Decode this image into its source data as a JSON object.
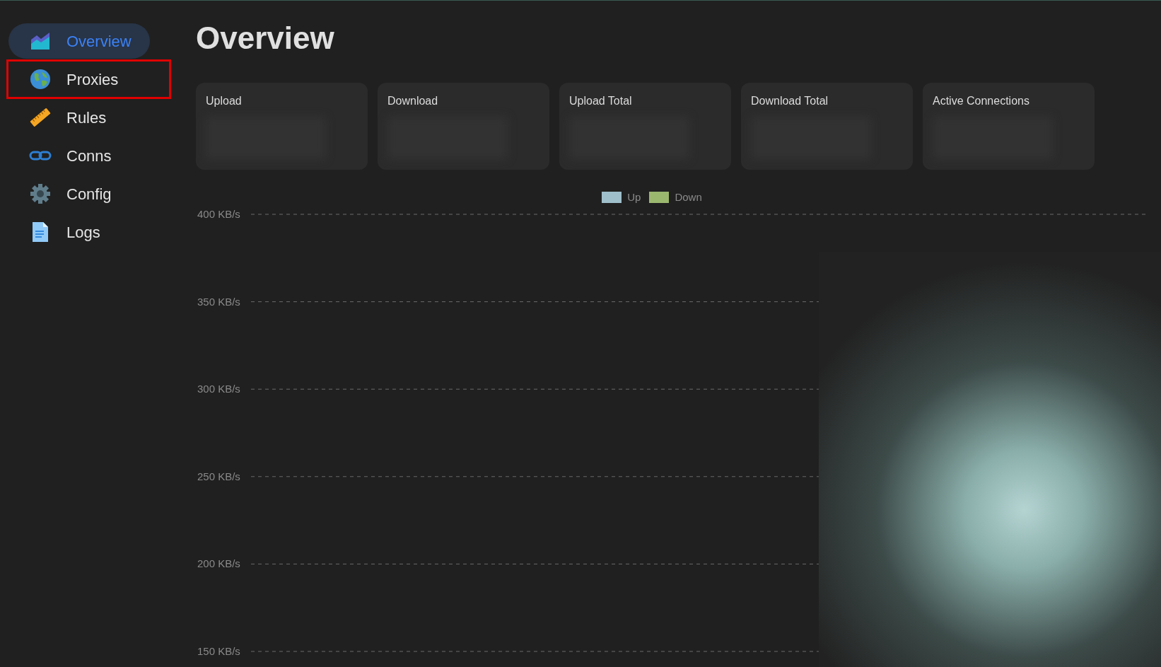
{
  "sidebar": {
    "items": [
      {
        "label": "Overview",
        "kind": "chart",
        "selected": true,
        "highlighted": false
      },
      {
        "label": "Proxies",
        "kind": "globe",
        "selected": false,
        "highlighted": true
      },
      {
        "label": "Rules",
        "kind": "ruler",
        "selected": false,
        "highlighted": false
      },
      {
        "label": "Conns",
        "kind": "link",
        "selected": false,
        "highlighted": false
      },
      {
        "label": "Config",
        "kind": "gear",
        "selected": false,
        "highlighted": false
      },
      {
        "label": "Logs",
        "kind": "doc",
        "selected": false,
        "highlighted": false
      }
    ]
  },
  "page": {
    "title": "Overview"
  },
  "stats": [
    {
      "label": "Upload"
    },
    {
      "label": "Download"
    },
    {
      "label": "Upload Total"
    },
    {
      "label": "Download Total"
    },
    {
      "label": "Active Connections"
    }
  ],
  "traffic_chart": {
    "chart_data": {
      "type": "line",
      "grid": true,
      "ylim": [
        150,
        400
      ],
      "series": [
        {
          "name": "Up",
          "color": "#9fbfcb"
        },
        {
          "name": "Down",
          "color": "#9bb86f"
        }
      ],
      "yticks": [
        {
          "value": 400,
          "label": "400 KB/s"
        },
        {
          "value": 350,
          "label": "350 KB/s"
        },
        {
          "value": 300,
          "label": "300 KB/s"
        },
        {
          "value": 250,
          "label": "250 KB/s"
        },
        {
          "value": 200,
          "label": "200 KB/s"
        },
        {
          "value": 150,
          "label": "150 KB/s"
        }
      ]
    }
  }
}
